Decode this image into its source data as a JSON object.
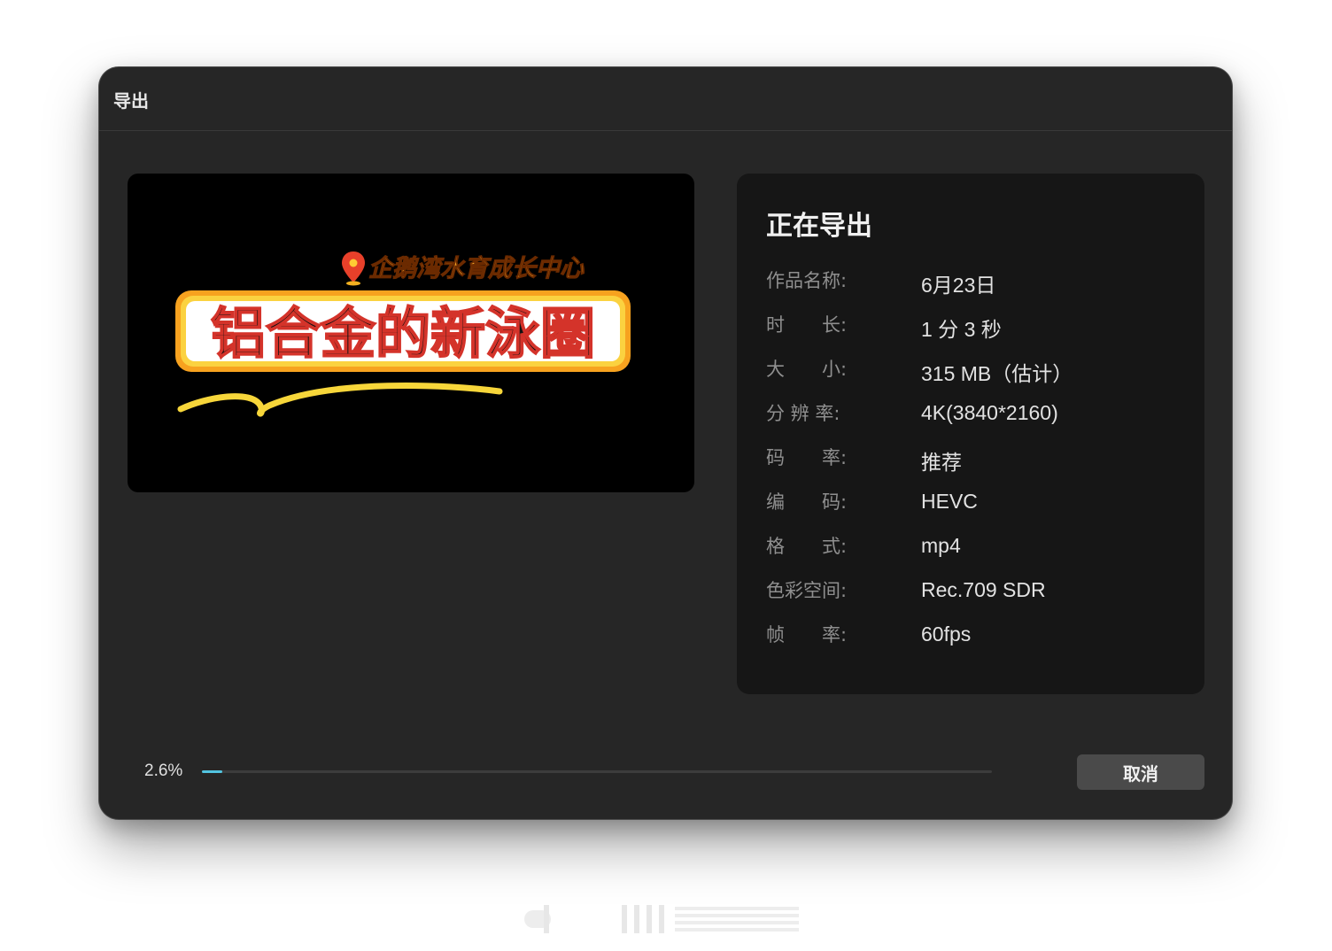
{
  "window": {
    "title": "导出"
  },
  "preview": {
    "location_text": "企鹅湾水育成长中心",
    "headline_text": "铝合金的新泳圈"
  },
  "info": {
    "heading": "正在导出",
    "rows": [
      {
        "label": "作品名称:",
        "value": "6月23日"
      },
      {
        "label": "时　　长:",
        "value": "1 分 3 秒"
      },
      {
        "label": "大　　小:",
        "value": "315 MB（估计）"
      },
      {
        "label": "分 辨 率:",
        "value": "4K(3840*2160)"
      },
      {
        "label": "码　　率:",
        "value": "推荐"
      },
      {
        "label": "编　　码:",
        "value": "HEVC"
      },
      {
        "label": "格　　式:",
        "value": "mp4"
      },
      {
        "label": "色彩空间:",
        "value": "Rec.709 SDR"
      },
      {
        "label": "帧　　率:",
        "value": "60fps"
      }
    ]
  },
  "progress": {
    "percent_text": "2.6%",
    "fraction": 0.026
  },
  "buttons": {
    "cancel": "取消"
  },
  "colors": {
    "accent": "#52c4e0",
    "dialog_bg": "#262626",
    "panel_bg": "#161616"
  }
}
